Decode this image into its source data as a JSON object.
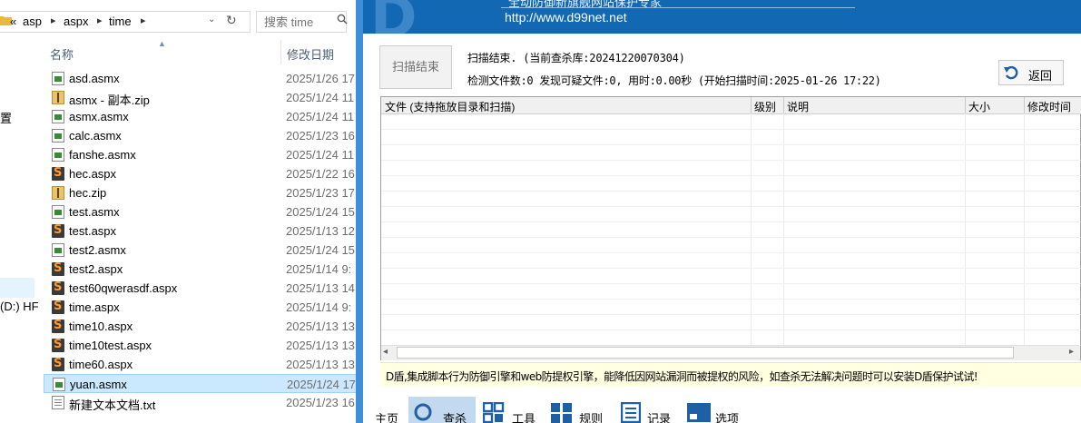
{
  "explorer": {
    "breadcrumb": {
      "overflow": "«",
      "segments": [
        "asp",
        "aspx",
        "time"
      ]
    },
    "search": {
      "placeholder": "搜索 time"
    },
    "columns": {
      "name": "名称",
      "modified": "修改日期"
    },
    "nav_items": [
      "置",
      "(D:) HF"
    ],
    "files": [
      {
        "name": "asd.asmx",
        "date": "2025/1/26 17",
        "icon": "asmx-file-icon"
      },
      {
        "name": "asmx - 副本.zip",
        "date": "2025/1/24 11",
        "icon": "zip-folder-icon"
      },
      {
        "name": "asmx.asmx",
        "date": "2025/1/24 11",
        "icon": "asmx-file-icon"
      },
      {
        "name": "calc.asmx",
        "date": "2025/1/23 16",
        "icon": "asmx-file-icon"
      },
      {
        "name": "fanshe.asmx",
        "date": "2025/1/24 11",
        "icon": "asmx-file-icon"
      },
      {
        "name": "hec.aspx",
        "date": "2025/1/22 16",
        "icon": "sublime-file-icon"
      },
      {
        "name": "hec.zip",
        "date": "2025/1/23 17",
        "icon": "zip-folder-icon"
      },
      {
        "name": "test.asmx",
        "date": "2025/1/24 15",
        "icon": "asmx-file-icon"
      },
      {
        "name": "test.aspx",
        "date": "2025/1/13 12",
        "icon": "sublime-file-icon"
      },
      {
        "name": "test2.asmx",
        "date": "2025/1/24 15",
        "icon": "asmx-file-icon"
      },
      {
        "name": "test2.aspx",
        "date": "2025/1/14 9:",
        "icon": "sublime-file-icon"
      },
      {
        "name": "test60qwerasdf.aspx",
        "date": "2025/1/13 14",
        "icon": "sublime-file-icon"
      },
      {
        "name": "time.aspx",
        "date": "2025/1/14 9:",
        "icon": "sublime-file-icon"
      },
      {
        "name": "time10.aspx",
        "date": "2025/1/13 13",
        "icon": "sublime-file-icon"
      },
      {
        "name": "time10test.aspx",
        "date": "2025/1/13 13",
        "icon": "sublime-file-icon"
      },
      {
        "name": "time60.aspx",
        "date": "2025/1/13 13",
        "icon": "sublime-file-icon"
      },
      {
        "name": "yuan.asmx",
        "date": "2025/1/24 17",
        "icon": "asmx-file-icon",
        "selected": true
      },
      {
        "name": "新建文本文档.txt",
        "date": "2025/1/23 16",
        "icon": "text-file-icon"
      }
    ]
  },
  "dshield": {
    "banner": {
      "logo": "D",
      "slogan": "全动防御新旗舰网站保护专家",
      "url": "http://www.d99net.net"
    },
    "scan_button": "扫描结束",
    "status_line1": "扫描结束. (当前查杀库:20241220070304)",
    "status_line2": "检测文件数:0 发现可疑文件:0, 用时:0.00秒 (开始扫描时间:2025-01-26 17:22)",
    "back_button": "返回",
    "grid_columns": [
      "文件 (支持拖放目录和扫描)",
      "级别",
      "说明",
      "大小",
      "修改时间"
    ],
    "info_text": "D盾,集成脚本行为防御引擎和web防提权引擎，能降低因网站漏洞而被提权的风险，如查杀无法解决问题时可以安装D盾保护试试!",
    "nav": [
      {
        "label": "主页",
        "icon": "home-icon"
      },
      {
        "label": "查杀",
        "icon": "scan-magnifier-icon",
        "active": true
      },
      {
        "label": "工具",
        "icon": "tools-icon"
      },
      {
        "label": "规则",
        "icon": "rules-icon"
      },
      {
        "label": "记录",
        "icon": "log-icon"
      },
      {
        "label": "选项",
        "icon": "options-icon"
      }
    ]
  },
  "colors": {
    "accent_blue": "#1268b3",
    "selection": "#cce8ff",
    "info_bar": "#ffffe1",
    "active_nav": "#c3d9ef"
  }
}
